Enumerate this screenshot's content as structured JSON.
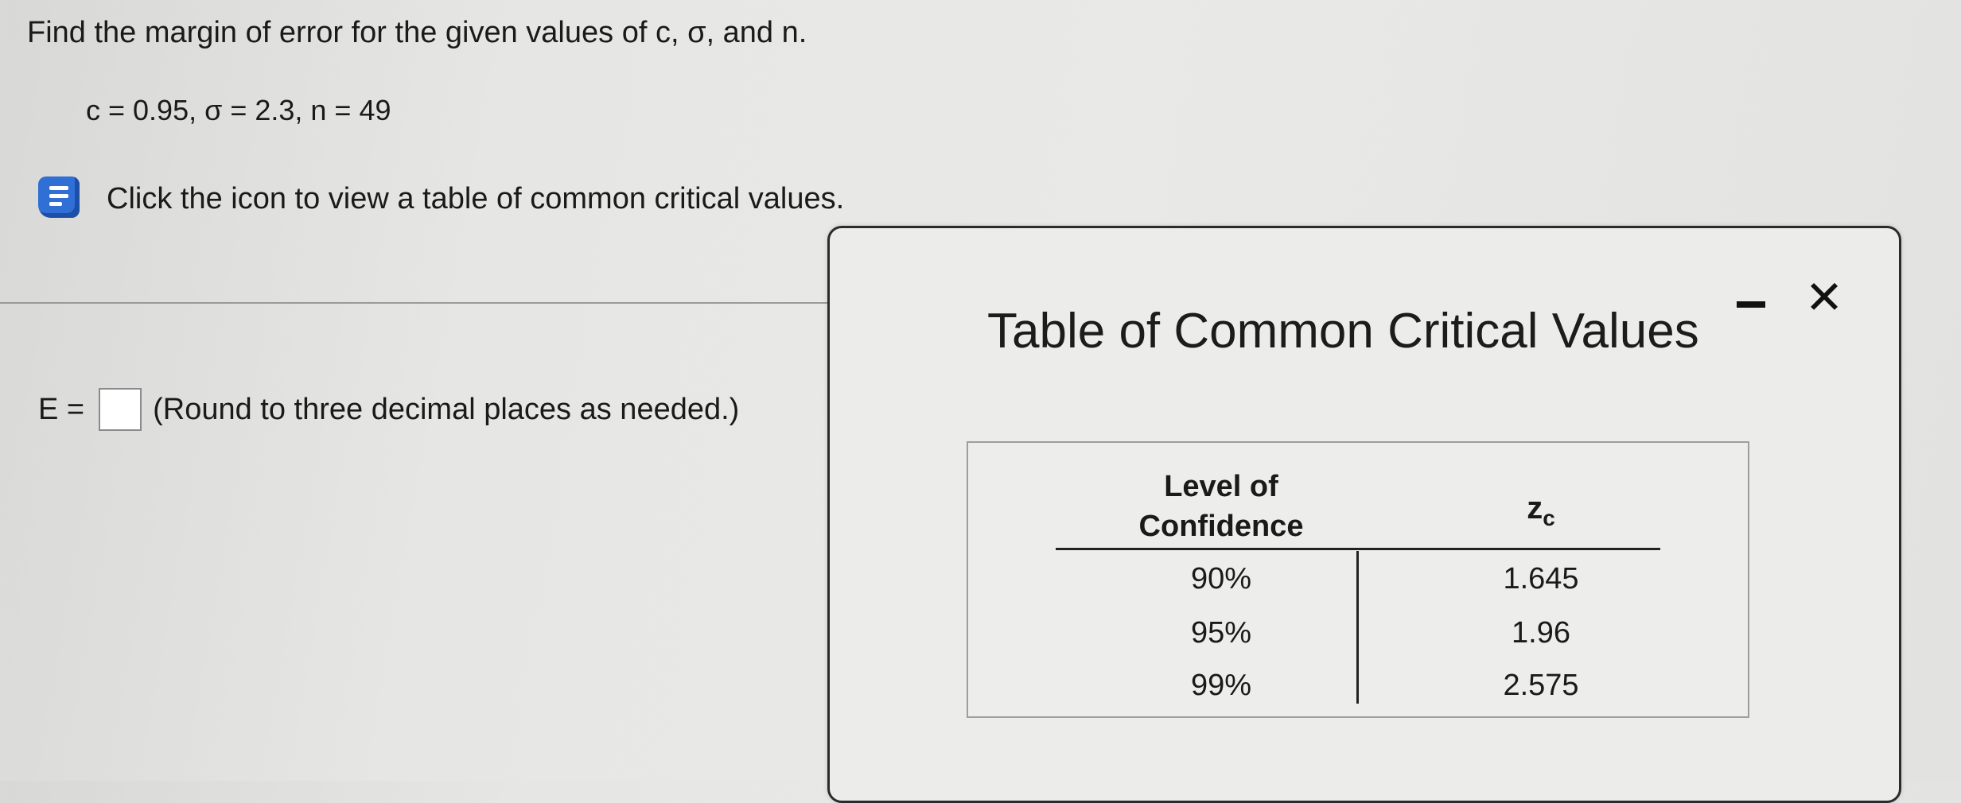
{
  "question": {
    "title": "Find the margin of error for the given values of c, σ, and n.",
    "given": "c = 0.95, σ = 2.3, n = 49"
  },
  "hint": {
    "icon": "book-icon",
    "text": "Click the icon to view a table of common critical values."
  },
  "answer": {
    "label": "E =",
    "value": "",
    "instruction": "(Round to three decimal places as needed.)"
  },
  "popup": {
    "title": "Table of Common Critical Values",
    "minimize_icon": "minimize-icon",
    "close_icon": "close-icon",
    "close_glyph": "✕",
    "table": {
      "header_level": "Level of Confidence",
      "header_z_main": "z",
      "header_z_sub": "c",
      "rows": [
        {
          "level": "90%",
          "z": "1.645"
        },
        {
          "level": "95%",
          "z": "1.96"
        },
        {
          "level": "99%",
          "z": "2.575"
        }
      ]
    }
  },
  "colors": {
    "icon_blue": "#2f6fd6",
    "background": "#e6e6e4"
  }
}
